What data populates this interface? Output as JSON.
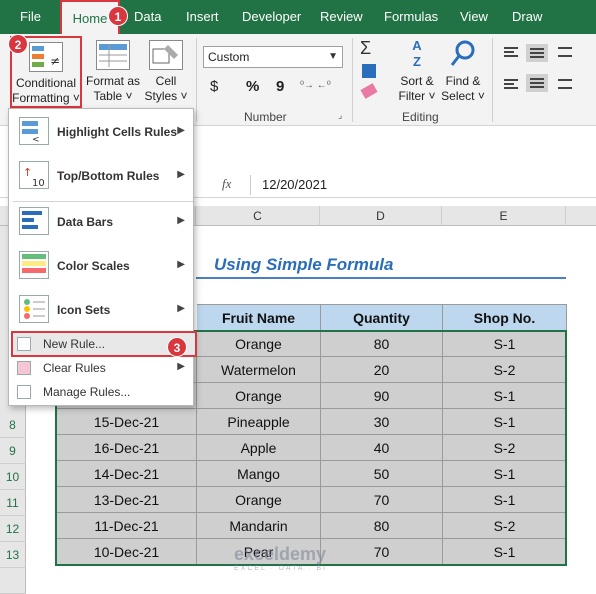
{
  "tabs": [
    {
      "label": "File"
    },
    {
      "label": "Home"
    },
    {
      "label": "Data"
    },
    {
      "label": "Insert"
    },
    {
      "label": "Developer"
    },
    {
      "label": "Review"
    },
    {
      "label": "Formulas"
    },
    {
      "label": "View"
    },
    {
      "label": "Draw"
    }
  ],
  "ribbon": {
    "conditional_formatting": {
      "line1": "Conditional",
      "line2": "Formatting ˅"
    },
    "format_as_table": {
      "line1": "Format as",
      "line2": "Table ˅"
    },
    "cell_styles": {
      "line1": "Cell",
      "line2": "Styles ˅"
    },
    "number_format": "Custom",
    "dollar": "$",
    "percent": "%",
    "comma": "9",
    "number_group": "Number",
    "sort_filter": {
      "line1": "Sort &",
      "line2": "Filter ˅"
    },
    "find_select": {
      "line1": "Find &",
      "line2": "Select ˅"
    },
    "editing_group": "Editing"
  },
  "badges": {
    "b1": "1",
    "b2": "2",
    "b3": "3"
  },
  "formula_bar": {
    "fx": "fx",
    "value": "12/20/2021"
  },
  "columns": [
    "C",
    "D",
    "E"
  ],
  "sheet_title": "Using Simple Formula",
  "table": {
    "headers": [
      "Fruit Name",
      "Quantity",
      "Shop No."
    ],
    "rows": [
      {
        "date": "",
        "fruit": "Orange",
        "qty": "80",
        "shop": "S-1"
      },
      {
        "date": "",
        "fruit": "Watermelon",
        "qty": "20",
        "shop": "S-2"
      },
      {
        "date": "",
        "fruit": "Orange",
        "qty": "90",
        "shop": "S-1"
      },
      {
        "date": "15-Dec-21",
        "fruit": "Pineapple",
        "qty": "30",
        "shop": "S-1"
      },
      {
        "date": "16-Dec-21",
        "fruit": "Apple",
        "qty": "40",
        "shop": "S-2"
      },
      {
        "date": "14-Dec-21",
        "fruit": "Mango",
        "qty": "50",
        "shop": "S-1"
      },
      {
        "date": "13-Dec-21",
        "fruit": "Orange",
        "qty": "70",
        "shop": "S-1"
      },
      {
        "date": "11-Dec-21",
        "fruit": "Mandarin",
        "qty": "80",
        "shop": "S-2"
      },
      {
        "date": "10-Dec-21",
        "fruit": "Pear",
        "qty": "70",
        "shop": "S-1"
      }
    ]
  },
  "row_numbers": [
    "8",
    "9",
    "10",
    "11",
    "12",
    "13"
  ],
  "menu": {
    "highlight": "Highlight Cells Rules",
    "topbottom": "Top/Bottom Rules",
    "databars": "Data Bars",
    "colorscales": "Color Scales",
    "iconsets": "Icon Sets",
    "newrule": "New Rule...",
    "clearrules": "Clear Rules",
    "managerules": "Manage Rules..."
  },
  "watermark": {
    "name": "exceldemy",
    "tagline": "EXCEL · DATA · BI"
  },
  "colors": {
    "excel_green": "#217346",
    "highlight_red": "#d9363e",
    "header_blue": "#bdd7ee"
  }
}
